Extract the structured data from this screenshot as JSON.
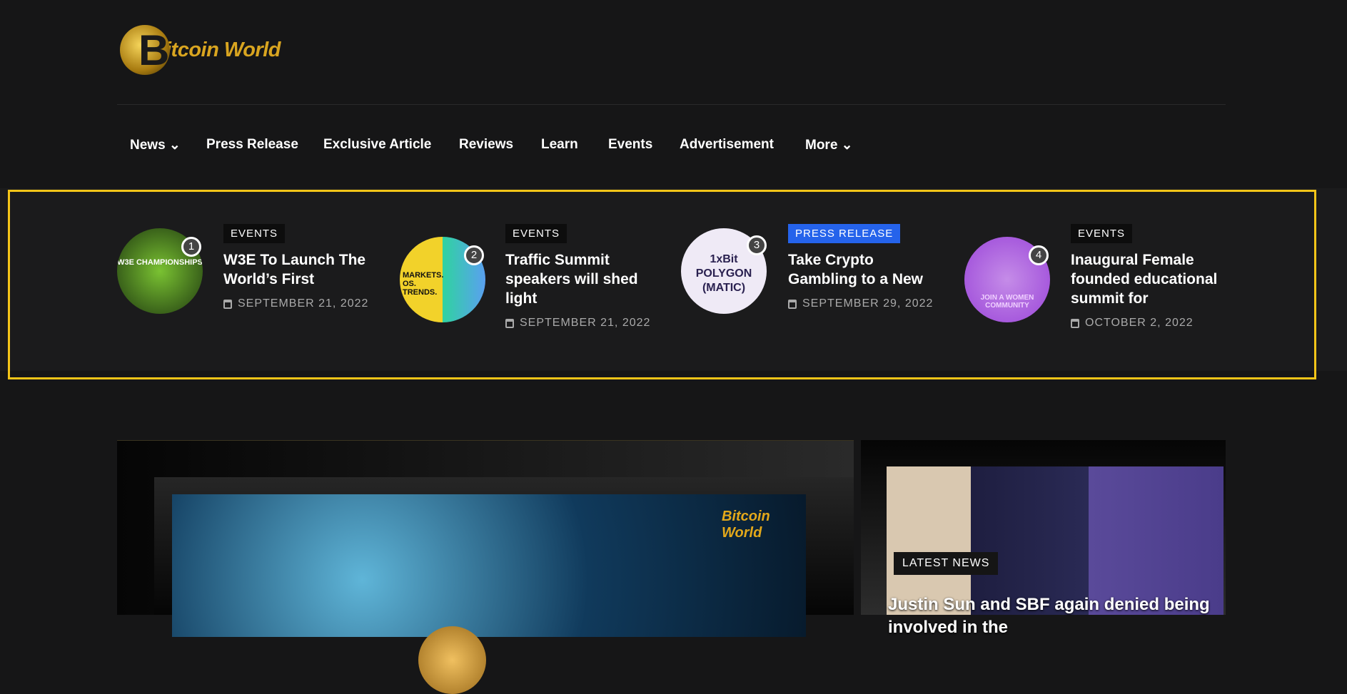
{
  "logo": {
    "text": "Bitcoin World",
    "letter": "B",
    "word": "itcoin World"
  },
  "nav": [
    {
      "label": "News ⌄"
    },
    {
      "label": "Press Release"
    },
    {
      "label": "Exclusive Article"
    },
    {
      "label": "Reviews"
    },
    {
      "label": "Learn"
    },
    {
      "label": "Events"
    },
    {
      "label": "Advertisement"
    },
    {
      "label": "More ⌄"
    }
  ],
  "trending": [
    {
      "rank": "1",
      "category": "EVENTS",
      "title": "W3E To Launch The World’s First",
      "date": "SEPTEMBER 21, 2022",
      "thumb_text": "W3E CHAMPIONSHIPS"
    },
    {
      "rank": "2",
      "category": "EVENTS",
      "title": "Traffic Summit speakers will shed light",
      "date": "SEPTEMBER 21, 2022",
      "thumb_text": "MARKETS. OS. TRENDS."
    },
    {
      "rank": "3",
      "category": "PRESS RELEASE",
      "title": "Take Crypto Gambling to a New",
      "date": "SEPTEMBER 29, 2022",
      "thumb_text": "1xBit POLYGON (MATIC)"
    },
    {
      "rank": "4",
      "category": "EVENTS",
      "title": "Inaugural Female founded educational summit for",
      "date": "OCTOBER 2, 2022",
      "thumb_text": "JOIN A WOMEN COMMUNITY"
    }
  ],
  "featured": {
    "watermark": "Bitcoin World"
  },
  "latest": {
    "label": "LATEST NEWS",
    "title": "Justin Sun and SBF again denied being involved in the"
  },
  "colors": {
    "highlight": "#f5c518",
    "press_badge": "#2563eb",
    "bg": "#161617"
  }
}
